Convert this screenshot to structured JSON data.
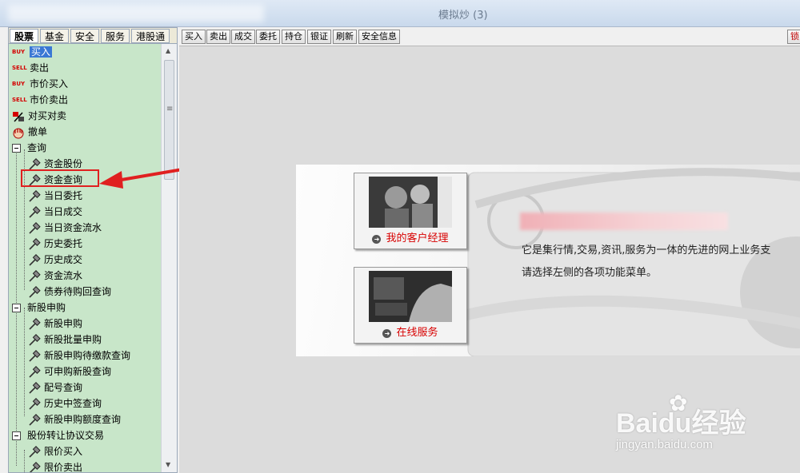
{
  "window": {
    "title": "模拟炒 (3)"
  },
  "tabs": [
    "股票",
    "基金",
    "安全",
    "服务",
    "港股通"
  ],
  "tree": {
    "trade_items": [
      {
        "icon": "BUY",
        "label": "买入"
      },
      {
        "icon": "SELL",
        "label": "卖出"
      },
      {
        "icon": "BUY",
        "label": "市价买入"
      },
      {
        "icon": "SELL",
        "label": "市价卖出"
      },
      {
        "icon": "buy-sell-icon",
        "label": "对买对卖"
      },
      {
        "icon": "cancel-hand-icon",
        "label": "撤单"
      }
    ],
    "groups": [
      {
        "label": "查询",
        "children": [
          "资金股份",
          "资金查询",
          "当日委托",
          "当日成交",
          "当日资金流水",
          "历史委托",
          "历史成交",
          "资金流水",
          "债券待购回查询"
        ]
      },
      {
        "label": "新股申购",
        "children": [
          "新股申购",
          "新股批量申购",
          "新股申购待缴款查询",
          "可申购新股查询",
          "配号查询",
          "历史中签查询",
          "新股申购额度查询"
        ]
      },
      {
        "label": "股份转让协议交易",
        "children": [
          "限价买入",
          "限价卖出"
        ]
      }
    ]
  },
  "toolbar": {
    "buttons": [
      "买入",
      "卖出",
      "成交",
      "委托",
      "持仓",
      "银证",
      "刷新",
      "安全信息"
    ],
    "lock_label": "锁"
  },
  "banner": {
    "card1_caption": "我的客户经理",
    "card2_caption": "在线服务",
    "line1": "它是集行情,交易,资讯,服务为一体的先进的网上业务支",
    "line2": "请选择左侧的各项功能菜单。"
  },
  "watermark": {
    "brand": "Baidu经验",
    "url": "jingyan.baidu.com"
  },
  "colors": {
    "tree_bg": "#c8e6c9",
    "selected": "#3a78d4",
    "highlight": "#e02020",
    "caption": "#d80000"
  }
}
